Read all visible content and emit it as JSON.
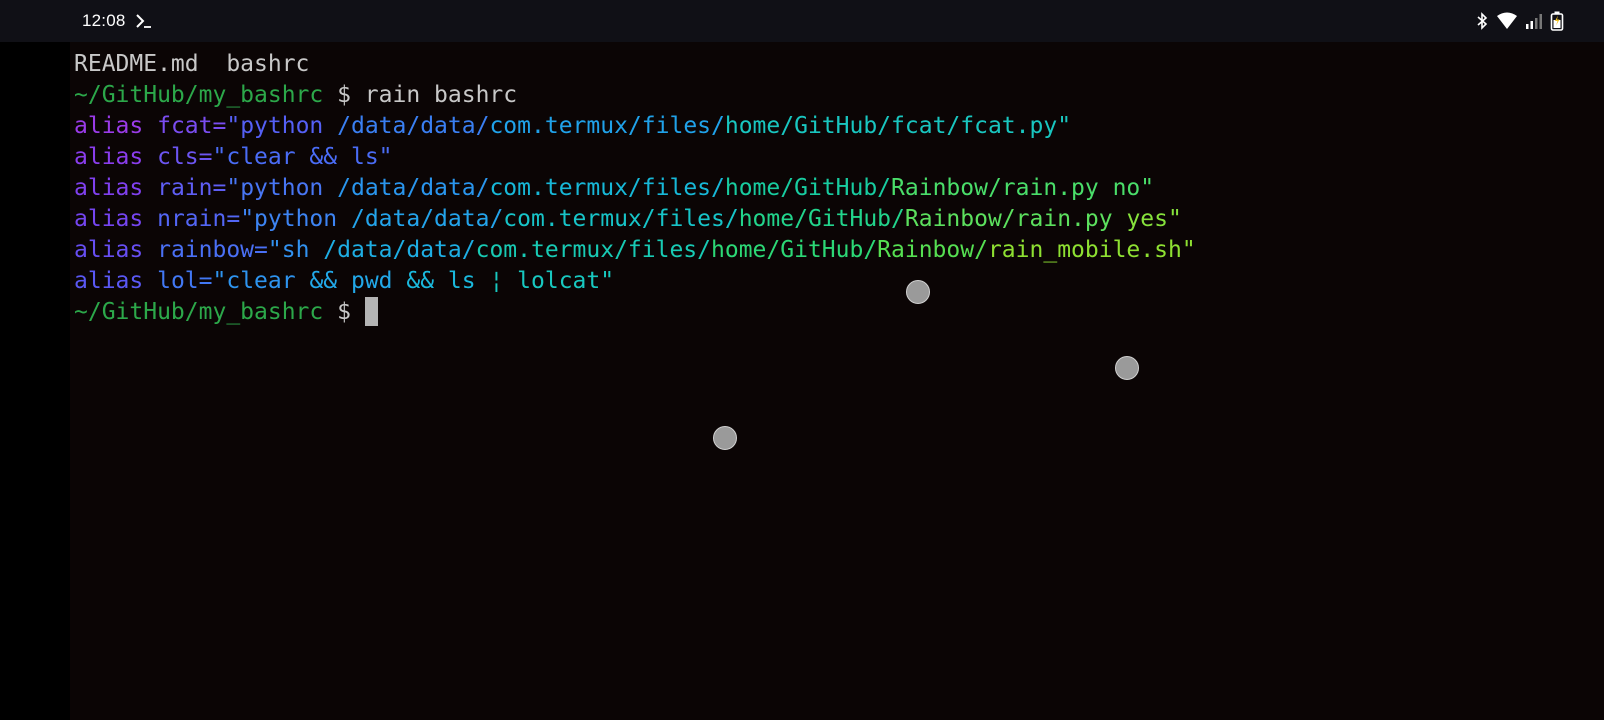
{
  "status_bar": {
    "time": "12:08",
    "icons": [
      "termux-prompt-icon",
      "bluetooth-icon",
      "wifi-icon",
      "cell-signal-icon",
      "battery-icon"
    ]
  },
  "colors": {
    "terminal_bg": "#0b0505",
    "status_bar_bg": "#101016",
    "default_text": "#c8c8c8",
    "prompt_green": "#2ca84a",
    "cursor": "#b4b4b4"
  },
  "terminal": {
    "lines": [
      [
        {
          "text": "README.md  bashrc",
          "color": "#c8c8c8"
        }
      ],
      [
        {
          "text": "~/GitHub/my_bashrc",
          "color": "#2ca84a"
        },
        {
          "text": " $ rain bashrc",
          "color": "#c8c8c8"
        }
      ],
      [
        {
          "text": "alias",
          "color": "#9a3be8"
        },
        {
          "text": " fcat=",
          "color": "#7a4df0"
        },
        {
          "text": "\"python ",
          "color": "#5560f5"
        },
        {
          "text": "/data/data/",
          "color": "#3a7ff2"
        },
        {
          "text": "com.termux/files/",
          "color": "#20a2ea"
        },
        {
          "text": "home/GitHub/fcat/fcat.py\"",
          "color": "#19c6c0"
        }
      ],
      [
        {
          "text": "alias",
          "color": "#8a3ded"
        },
        {
          "text": " cls=",
          "color": "#6c55f2"
        },
        {
          "text": "\"clear && ls\"",
          "color": "#4a6cf5"
        }
      ],
      [
        {
          "text": "alias",
          "color": "#8040ef"
        },
        {
          "text": " rain=",
          "color": "#5f5ef4"
        },
        {
          "text": "\"python ",
          "color": "#4876f4"
        },
        {
          "text": "/data/data/",
          "color": "#2a96ee"
        },
        {
          "text": "com.termux/files/",
          "color": "#17b8d8"
        },
        {
          "text": "home/GitHub/",
          "color": "#18cca0"
        },
        {
          "text": "Rainbow/rain.py no\"",
          "color": "#4ade6a"
        }
      ],
      [
        {
          "text": "alias",
          "color": "#7545f1"
        },
        {
          "text": " nrain=",
          "color": "#5366f5"
        },
        {
          "text": "\"python ",
          "color": "#3d84f3"
        },
        {
          "text": "/data/data/",
          "color": "#24a4eb"
        },
        {
          "text": "com.termux/files/",
          "color": "#17c4c8"
        },
        {
          "text": "home/GitHub/",
          "color": "#22d48c"
        },
        {
          "text": "Rainbow/rain.py ",
          "color": "#5ce05e"
        },
        {
          "text": "yes\"",
          "color": "#86e23c"
        }
      ],
      [
        {
          "text": "alias",
          "color": "#674ef3"
        },
        {
          "text": " rainbow=",
          "color": "#4a70f5"
        },
        {
          "text": "\"sh ",
          "color": "#3292f0"
        },
        {
          "text": "/data/data/",
          "color": "#1eaee4"
        },
        {
          "text": "com.termux/files/",
          "color": "#18cab4"
        },
        {
          "text": "home/GitHub/",
          "color": "#2cd876"
        },
        {
          "text": "Rainbow/",
          "color": "#56df52"
        },
        {
          "text": "rain_mobile.sh\"",
          "color": "#8ee032"
        }
      ],
      [
        {
          "text": "alias",
          "color": "#5a58f4"
        },
        {
          "text": " lol=",
          "color": "#4278f4"
        },
        {
          "text": "\"clear ",
          "color": "#2e94ef"
        },
        {
          "text": "&& pwd ",
          "color": "#22a8e8"
        },
        {
          "text": "&& ls ",
          "color": "#1ab8dc"
        },
        {
          "text": "¦ lolcat\"",
          "color": "#18c8c0"
        }
      ],
      [
        {
          "text": "~/GitHub/my_bashrc",
          "color": "#2ca84a"
        },
        {
          "text": " $ ",
          "color": "#c8c8c8"
        }
      ]
    ]
  }
}
